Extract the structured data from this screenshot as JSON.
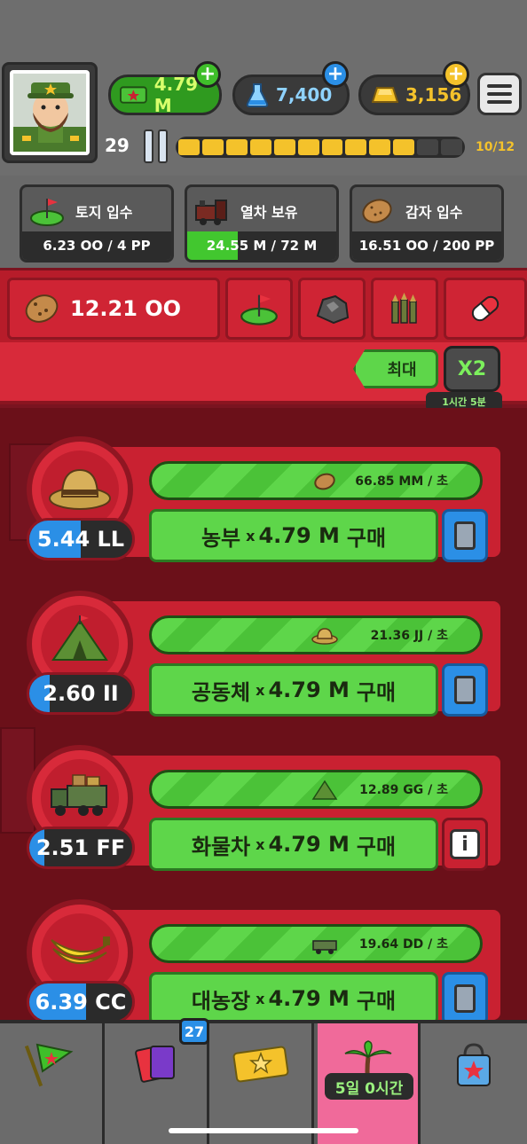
{
  "colors": {
    "accent_green": "#5ed64a",
    "accent_red": "#c92131",
    "accent_blue": "#2b8fe6",
    "gold": "#f4c22b"
  },
  "resources": {
    "cash": "4.79 M",
    "science": "7,400",
    "gold": "3,156"
  },
  "player": {
    "level": "29",
    "xp_text": "10/12",
    "xp_segments_filled": 10,
    "xp_segments_total": 12
  },
  "quests": [
    {
      "name": "토지 입수",
      "progress": "6.23 OO / 4 PP",
      "fill_fraction": 0.0,
      "icon": "land-flag-icon"
    },
    {
      "name": "열차 보유",
      "progress": "24.55 M / 72 M",
      "fill_fraction": 0.34,
      "icon": "train-icon"
    },
    {
      "name": "감자 입수",
      "progress": "16.51 OO / 200 PP",
      "fill_fraction": 0.0,
      "icon": "potato-icon"
    }
  ],
  "resource_tabs": {
    "potato_count": "12.21 OO",
    "icons": [
      "land-flag-icon",
      "ore-icon",
      "ammo-icon",
      "pill-icon"
    ]
  },
  "controls": {
    "max_label": "최대",
    "x2_label": "X2",
    "x2_timer": "1시간 5분"
  },
  "producers": [
    {
      "level": "5.44 LL",
      "level_fill": 0.5,
      "rate": "66.85 MM / 초",
      "buy_name": "농부",
      "buy_x": "x",
      "buy_amount": "4.79 M",
      "buy_action": "구매",
      "side": "upgrade",
      "icon": "straw-hat-icon",
      "rate_icon": "potato-icon"
    },
    {
      "level": "2.60 II",
      "level_fill": 0.2,
      "rate": "21.36 JJ / 초",
      "buy_name": "공동체",
      "buy_x": "x",
      "buy_amount": "4.79 M",
      "buy_action": "구매",
      "side": "upgrade",
      "icon": "tent-icon",
      "rate_icon": "straw-hat-icon"
    },
    {
      "level": "2.51 FF",
      "level_fill": 0.15,
      "rate": "12.89 GG / 초",
      "buy_name": "화물차",
      "buy_x": "x",
      "buy_amount": "4.79 M",
      "buy_action": "구매",
      "side": "info",
      "icon": "cargo-truck-icon",
      "rate_icon": "tent-icon"
    },
    {
      "level": "6.39 CC",
      "level_fill": 0.55,
      "rate": "19.64 DD / 초",
      "buy_name": "대농장",
      "buy_x": "x",
      "buy_amount": "4.79 M",
      "buy_action": "구매",
      "side": "upgrade",
      "icon": "banana-icon",
      "rate_icon": "cargo-truck-icon"
    }
  ],
  "bottom_nav": {
    "cards_badge": "27",
    "event_timer": "5일 0시간"
  }
}
